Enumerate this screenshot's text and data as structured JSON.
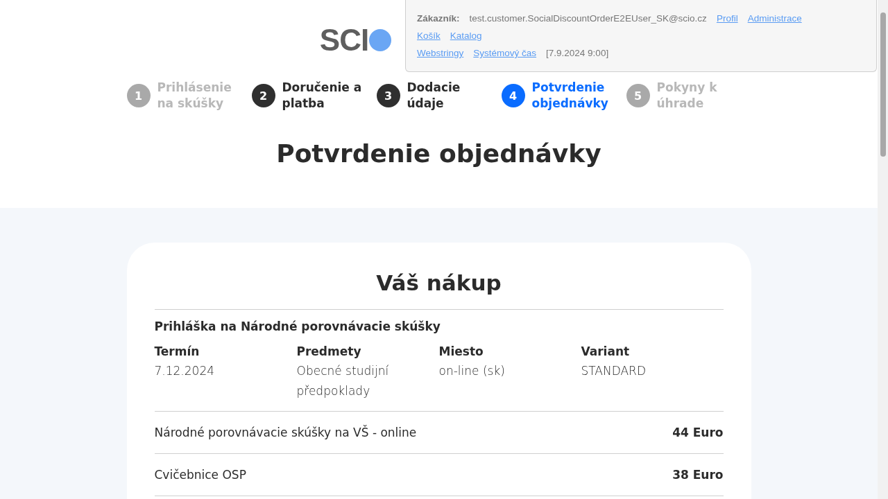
{
  "logo": {
    "text": "SCI"
  },
  "admin_panel": {
    "customer_label": "Zákazník:",
    "customer_email": "test.customer.SocialDiscountOrderE2EUser_SK@scio.cz",
    "links_row1": [
      "Profil",
      "Administrace"
    ],
    "links_row2": [
      "Košík",
      "Katalog"
    ],
    "links_row3": [
      "Webstringy",
      "Systémový čas"
    ],
    "system_time": "[7.9.2024 9:00]"
  },
  "steps": [
    {
      "number": "1",
      "label": "Prihlásenie na skúšky",
      "selected": false,
      "disabled": true
    },
    {
      "number": "2",
      "label": "Doručenie a platba",
      "selected": false,
      "disabled": false
    },
    {
      "number": "3",
      "label": "Dodacie údaje",
      "selected": false,
      "disabled": false
    },
    {
      "number": "4",
      "label": "Potvrdenie objednávky",
      "selected": true,
      "disabled": false
    },
    {
      "number": "5",
      "label": "Pokyny k úhrade",
      "selected": false,
      "disabled": true
    }
  ],
  "page_title": "Potvrdenie objednávky",
  "purchase": {
    "title": "Váš nákup",
    "registration_title": "Prihláška na Národné porovnávacie skúšky",
    "columns": [
      {
        "heading": "Termín",
        "value": "7.12.2024"
      },
      {
        "heading": "Predmety",
        "value": "Obecné studijní předpoklady"
      },
      {
        "heading": "Miesto",
        "value": "on-line (sk)"
      },
      {
        "heading": "Variant",
        "value": "STANDARD"
      }
    ],
    "items": [
      {
        "name": "Národné porovnávacie skúšky na VŠ - online",
        "price": "44 Euro"
      },
      {
        "name": "Cvičebnice OSP",
        "price": "38 Euro"
      }
    ]
  }
}
